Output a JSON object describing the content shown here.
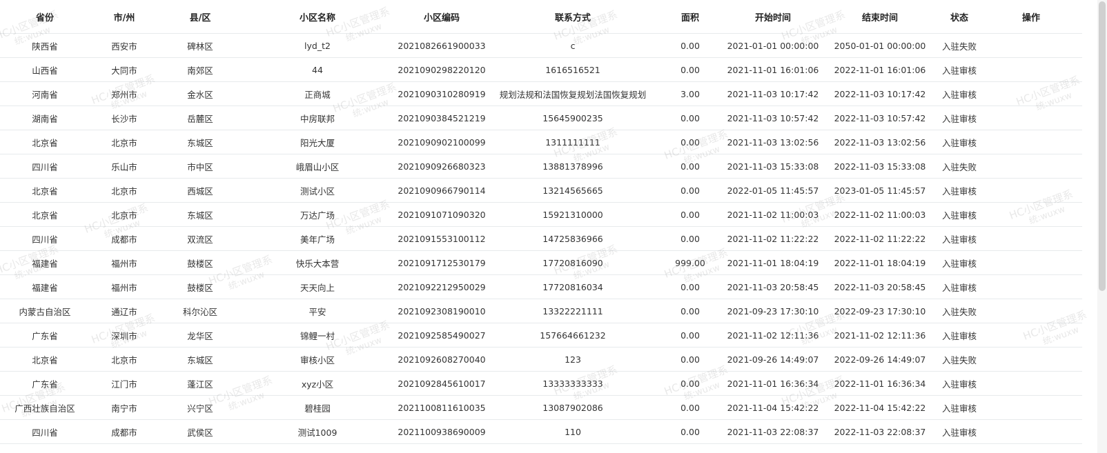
{
  "table": {
    "headers": [
      "省份",
      "市/州",
      "县/区",
      "小区名称",
      "小区编码",
      "联系方式",
      "面积",
      "开始时间",
      "结束时间",
      "状态",
      "操作"
    ],
    "rows": [
      [
        "陕西省",
        "西安市",
        "碑林区",
        "lyd_t2",
        "2021082661900033",
        "c",
        "0.00",
        "2021-01-01 00:00:00",
        "2050-01-01 00:00:00",
        "入驻失败",
        ""
      ],
      [
        "山西省",
        "大同市",
        "南郊区",
        "44",
        "2021090298220120",
        "1616516521",
        "0.00",
        "2021-11-01 16:01:06",
        "2022-11-01 16:01:06",
        "入驻审核",
        ""
      ],
      [
        "河南省",
        "郑州市",
        "金水区",
        "正商城",
        "2021090310280919",
        "规划法规和法国恢复规划法国恢复规划",
        "3.00",
        "2021-11-03 10:17:42",
        "2022-11-03 10:17:42",
        "入驻审核",
        ""
      ],
      [
        "湖南省",
        "长沙市",
        "岳麓区",
        "中房联邦",
        "2021090384521219",
        "15645900235",
        "0.00",
        "2021-11-03 10:57:42",
        "2022-11-03 10:57:42",
        "入驻审核",
        ""
      ],
      [
        "北京省",
        "北京市",
        "东城区",
        "阳光大厦",
        "2021090902100099",
        "1311111111",
        "0.00",
        "2021-11-03 13:02:56",
        "2022-11-03 13:02:56",
        "入驻审核",
        ""
      ],
      [
        "四川省",
        "乐山市",
        "市中区",
        "峨眉山小区",
        "2021090926680323",
        "13881378996",
        "0.00",
        "2021-11-03 15:33:08",
        "2022-11-03 15:33:08",
        "入驻失败",
        ""
      ],
      [
        "北京省",
        "北京市",
        "西城区",
        "测试小区",
        "2021090966790114",
        "13214565665",
        "0.00",
        "2022-01-05 11:45:57",
        "2023-01-05 11:45:57",
        "入驻审核",
        ""
      ],
      [
        "北京省",
        "北京市",
        "东城区",
        "万达广场",
        "2021091071090320",
        "15921310000",
        "0.00",
        "2021-11-02 11:00:03",
        "2022-11-02 11:00:03",
        "入驻审核",
        ""
      ],
      [
        "四川省",
        "成都市",
        "双流区",
        "美年广场",
        "2021091553100112",
        "14725836966",
        "0.00",
        "2021-11-02 11:22:22",
        "2022-11-02 11:22:22",
        "入驻审核",
        ""
      ],
      [
        "福建省",
        "福州市",
        "鼓楼区",
        "快乐大本营",
        "2021091712530179",
        "17720816090",
        "999.00",
        "2021-11-01 18:04:19",
        "2022-11-01 18:04:19",
        "入驻审核",
        ""
      ],
      [
        "福建省",
        "福州市",
        "鼓楼区",
        "天天向上",
        "2021092212950029",
        "17720816034",
        "0.00",
        "2021-11-03 20:58:45",
        "2022-11-03 20:58:45",
        "入驻审核",
        ""
      ],
      [
        "内蒙古自治区",
        "通辽市",
        "科尔沁区",
        "平安",
        "2021092308190010",
        "13322221111",
        "0.00",
        "2021-09-23 17:30:10",
        "2022-09-23 17:30:10",
        "入驻失败",
        ""
      ],
      [
        "广东省",
        "深圳市",
        "龙华区",
        "锦鲤一村",
        "2021092585490027",
        "157664661232",
        "0.00",
        "2021-11-02 12:11:36",
        "2021-11-02 12:11:36",
        "入驻审核",
        ""
      ],
      [
        "北京省",
        "北京市",
        "东城区",
        "审核小区",
        "2021092608270040",
        "123",
        "0.00",
        "2021-09-26 14:49:07",
        "2022-09-26 14:49:07",
        "入驻失败",
        ""
      ],
      [
        "广东省",
        "江门市",
        "蓬江区",
        "xyz小区",
        "2021092845610017",
        "13333333333",
        "0.00",
        "2021-11-01 16:36:34",
        "2022-11-01 16:36:34",
        "入驻审核",
        ""
      ],
      [
        "广西壮族自治区",
        "南宁市",
        "兴宁区",
        "碧桂园",
        "2021100811610035",
        "13087902086",
        "0.00",
        "2021-11-04 15:42:22",
        "2022-11-04 15:42:22",
        "入驻审核",
        ""
      ],
      [
        "四川省",
        "成都市",
        "武侯区",
        "测试1009",
        "2021100938690009",
        "110",
        "0.00",
        "2021-11-03 22:08:37",
        "2022-11-03 22:08:37",
        "入驻审核",
        ""
      ]
    ]
  },
  "watermark": {
    "line1": "HC小区管理系",
    "line2": "统:wuxw"
  }
}
